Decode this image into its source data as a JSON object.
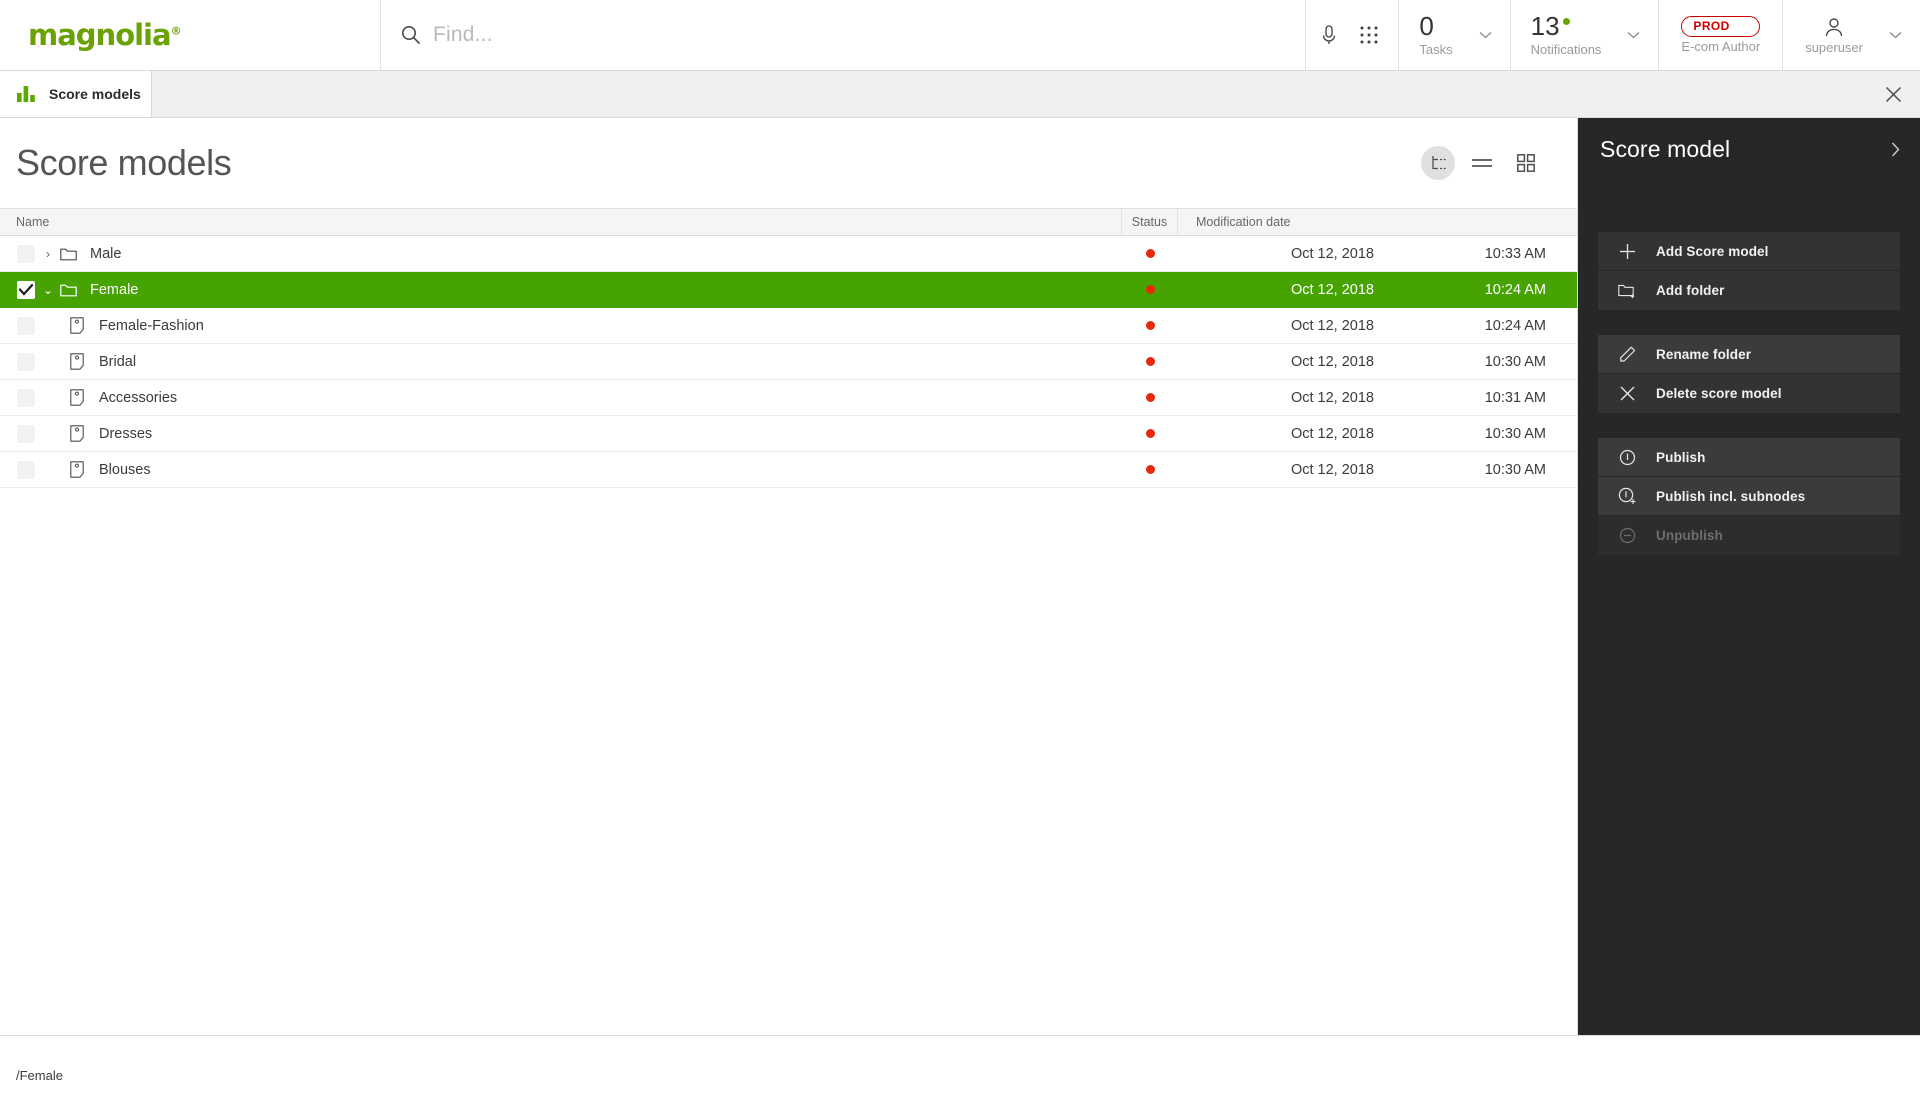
{
  "header": {
    "brand": {
      "name": "magnolia",
      "registered": "®",
      "color": "#6aa204"
    },
    "search": {
      "placeholder": "Find...",
      "value": "",
      "icon": "search-icon"
    },
    "mic_icon": "microphone-icon",
    "apps_icon": "apps-grid-icon",
    "cells": [
      {
        "value": "0",
        "label": "Tasks",
        "icon": "chevron-down-icon"
      },
      {
        "value": "13",
        "label": "Notifications",
        "badge": true,
        "icon": "chevron-down-icon"
      },
      {
        "value": "PROD",
        "label": "E-com Author",
        "icon": "chevron-down-icon"
      },
      {
        "value": "",
        "label": "superuser",
        "icon": "chevron-down-icon",
        "avatar": "user-icon"
      }
    ]
  },
  "tabbar": {
    "tab_label": "Score models",
    "tab_icon": "bar-chart-icon",
    "close_icon": "close-icon"
  },
  "page": {
    "title": "Score models",
    "view_toggles": [
      {
        "name": "tree-view",
        "icon": "tree-view-icon",
        "active": true
      },
      {
        "name": "list-view",
        "icon": "list-view-icon",
        "active": false
      },
      {
        "name": "grid-view",
        "icon": "grid-view-icon",
        "active": false
      }
    ]
  },
  "table": {
    "columns": {
      "name": "Name",
      "status": "Status",
      "modification_date": "Modification date"
    },
    "rows": [
      {
        "name": "Male",
        "icon": "folder-icon",
        "twisty": "›",
        "expanded": false,
        "indent": 0,
        "checked": false,
        "selected": false,
        "status": "red",
        "date": "Oct 12, 2018",
        "time": "10:33 AM"
      },
      {
        "name": "Female",
        "icon": "folder-icon",
        "twisty": "⌄",
        "expanded": true,
        "indent": 0,
        "checked": true,
        "selected": true,
        "status": "red",
        "date": "Oct 12, 2018",
        "time": "10:24 AM"
      },
      {
        "name": "Female-Fashion",
        "icon": "page-icon",
        "twisty": "",
        "expanded": false,
        "indent": 1,
        "checked": false,
        "selected": false,
        "status": "red",
        "date": "Oct 12, 2018",
        "time": "10:24 AM"
      },
      {
        "name": "Bridal",
        "icon": "page-icon",
        "twisty": "",
        "expanded": false,
        "indent": 1,
        "checked": false,
        "selected": false,
        "status": "red",
        "date": "Oct 12, 2018",
        "time": "10:30 AM"
      },
      {
        "name": "Accessories",
        "icon": "page-icon",
        "twisty": "",
        "expanded": false,
        "indent": 1,
        "checked": false,
        "selected": false,
        "status": "red",
        "date": "Oct 12, 2018",
        "time": "10:31 AM"
      },
      {
        "name": "Dresses",
        "icon": "page-icon",
        "twisty": "",
        "expanded": false,
        "indent": 1,
        "checked": false,
        "selected": false,
        "status": "red",
        "date": "Oct 12, 2018",
        "time": "10:30 AM"
      },
      {
        "name": "Blouses",
        "icon": "page-icon",
        "twisty": "",
        "expanded": false,
        "indent": 1,
        "checked": false,
        "selected": false,
        "status": "red",
        "date": "Oct 12, 2018",
        "time": "10:30 AM"
      }
    ]
  },
  "action_panel": {
    "title": "Score model",
    "collapse_icon": "chevron-right-icon",
    "groups": [
      {
        "items": [
          {
            "label": "Add Score model",
            "icon": "plus-icon",
            "state": "normal"
          },
          {
            "label": "Add folder",
            "icon": "folder-add-icon",
            "state": "normal"
          }
        ]
      },
      {
        "items": [
          {
            "label": "Rename folder",
            "icon": "pencil-icon",
            "state": "hover"
          },
          {
            "label": "Delete score model",
            "icon": "close-icon",
            "state": "normal"
          }
        ]
      },
      {
        "items": [
          {
            "label": "Publish",
            "icon": "publish-icon",
            "state": "hover"
          },
          {
            "label": "Publish incl. subnodes",
            "icon": "publish-subnodes-icon",
            "state": "hover"
          },
          {
            "label": "Unpublish",
            "icon": "unpublish-icon",
            "state": "disabled"
          }
        ]
      }
    ]
  },
  "footer": {
    "path": "/Female"
  },
  "colors": {
    "accent_green": "#46a302",
    "brand_green": "#6aa204",
    "status_red": "#e8280c",
    "panel_dark": "#272727"
  }
}
